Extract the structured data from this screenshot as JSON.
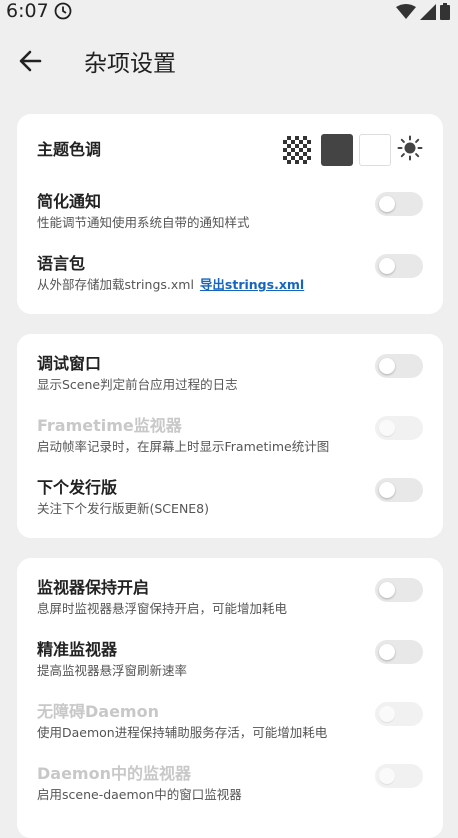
{
  "status": {
    "time": "6:07"
  },
  "appbar": {
    "title": "杂项设置"
  },
  "card1": {
    "theme": {
      "label": "主题色调"
    },
    "simple_notify": {
      "label": "简化通知",
      "sub": "性能调节通知使用系统自带的通知样式"
    },
    "lang_pack": {
      "label": "语言包",
      "sub": "从外部存储加载strings.xml",
      "link": "导出strings.xml"
    }
  },
  "card2": {
    "debug_window": {
      "label": "调试窗口",
      "sub": "显示Scene判定前台应用过程的日志"
    },
    "frametime": {
      "label": "Frametime监视器",
      "sub": "启动帧率记录时，在屏幕上时显示Frametime统计图"
    },
    "next_release": {
      "label": "下个发行版",
      "sub": "关注下个发行版更新(SCENE8)"
    }
  },
  "card3": {
    "monitor_keep": {
      "label": "监视器保持开启",
      "sub": "息屏时监视器悬浮窗保持开启，可能增加耗电"
    },
    "precise_monitor": {
      "label": "精准监视器",
      "sub": "提高监视器悬浮窗刷新速率"
    },
    "accessibility_daemon": {
      "label": "无障碍Daemon",
      "sub": "使用Daemon进程保持辅助服务存活，可能增加耗电"
    },
    "daemon_monitor": {
      "label": "Daemon中的监视器",
      "sub": "启用scene-daemon中的窗口监视器"
    }
  }
}
